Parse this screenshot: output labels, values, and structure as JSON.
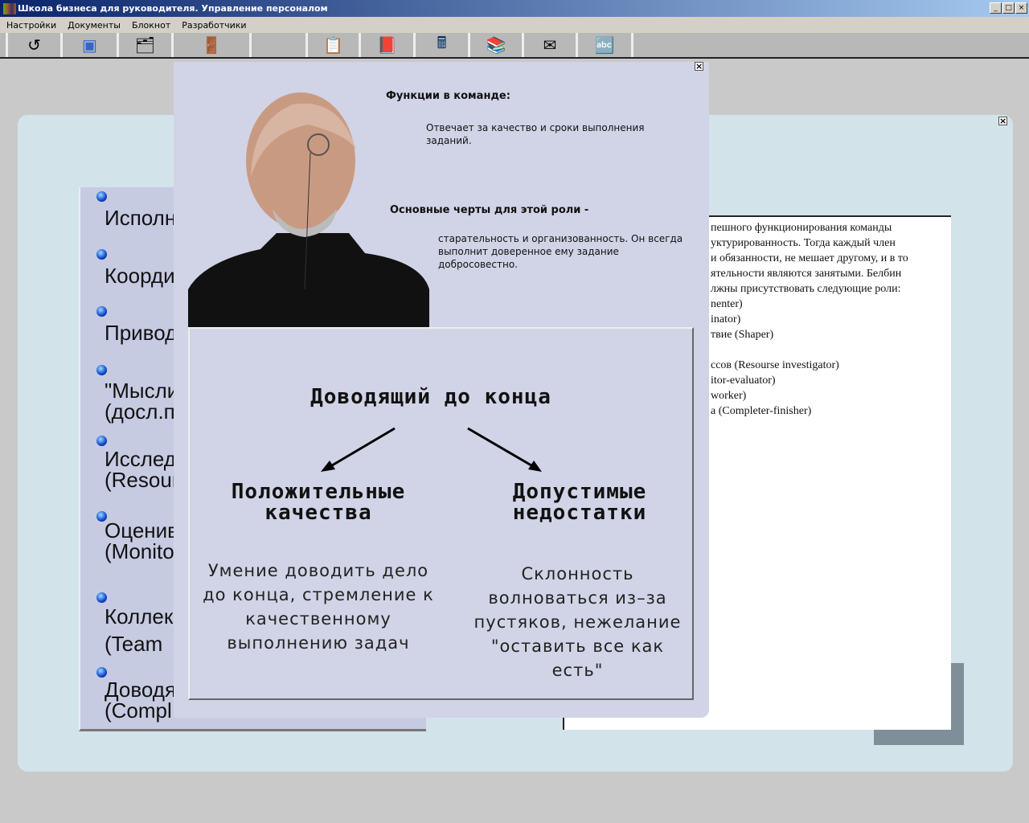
{
  "window": {
    "title": "Школа бизнеса для руководителя. Управление персоналом",
    "controls": [
      "_",
      "□",
      "×"
    ]
  },
  "menu": [
    "Настройки",
    "Документы",
    "Блокнот",
    "Разработчики"
  ],
  "toolbar": [
    {
      "icon": "logo-icon",
      "glyph": "↺"
    },
    {
      "icon": "cubes-icon",
      "glyph": "▣"
    },
    {
      "icon": "folders-icon",
      "glyph": "🗂"
    },
    {
      "icon": "exit-door-icon",
      "glyph": "🚪"
    },
    {
      "icon": "empty",
      "glyph": ""
    },
    {
      "icon": "clipboard-icon",
      "glyph": "📋"
    },
    {
      "icon": "notebook-icon",
      "glyph": "📕"
    },
    {
      "icon": "calculator-icon",
      "glyph": "🖩"
    },
    {
      "icon": "books-icon",
      "glyph": "📚"
    },
    {
      "icon": "mail-icon",
      "glyph": "✉"
    },
    {
      "icon": "abc-icon",
      "glyph": "🔤"
    }
  ],
  "roles": [
    "Исполн",
    "Коорди",
    "Привод",
    "\"Мысли\n(досл.п",
    "Исслед\n(Resour",
    "Оценив\n(Monito",
    "Коллек\n(Team ",
    "Доводя\n(Compl"
  ],
  "right_text": [
    "пешного  функционирования  команды",
    "уктурированность.  Тогда  каждый  член",
    "и обязанности, не мешает другому, и в то",
    "ятельности   являются занятыми. Белбин",
    "лжны присутствовать следующие роли:",
    "nenter)",
    "inator)",
    "твие (Shaper)",
    "",
    "ссов (Resourse investigator)",
    "itor-evaluator)",
    "worker)",
    "а (Completer-finisher)"
  ],
  "popup": {
    "functions_heading": "Функции в команде:",
    "functions_text": "Отвечает за качество и сроки выполнения заданий.",
    "traits_heading": "Основные черты для этой роли -",
    "traits_text": "старательность и организованность. Он всегда выполнит доверенное ему задание добросовестно.",
    "role_title": "Доводящий до конца",
    "positive_heading": "Положительные качества",
    "positive_text": "Умение доводить дело до конца, стремление к качественному выполнению задач",
    "negative_heading": "Допустимые недостатки",
    "negative_text": "Склонность волноваться из–за пустяков, нежелание \"оставить все как есть\""
  },
  "close_label": "×"
}
